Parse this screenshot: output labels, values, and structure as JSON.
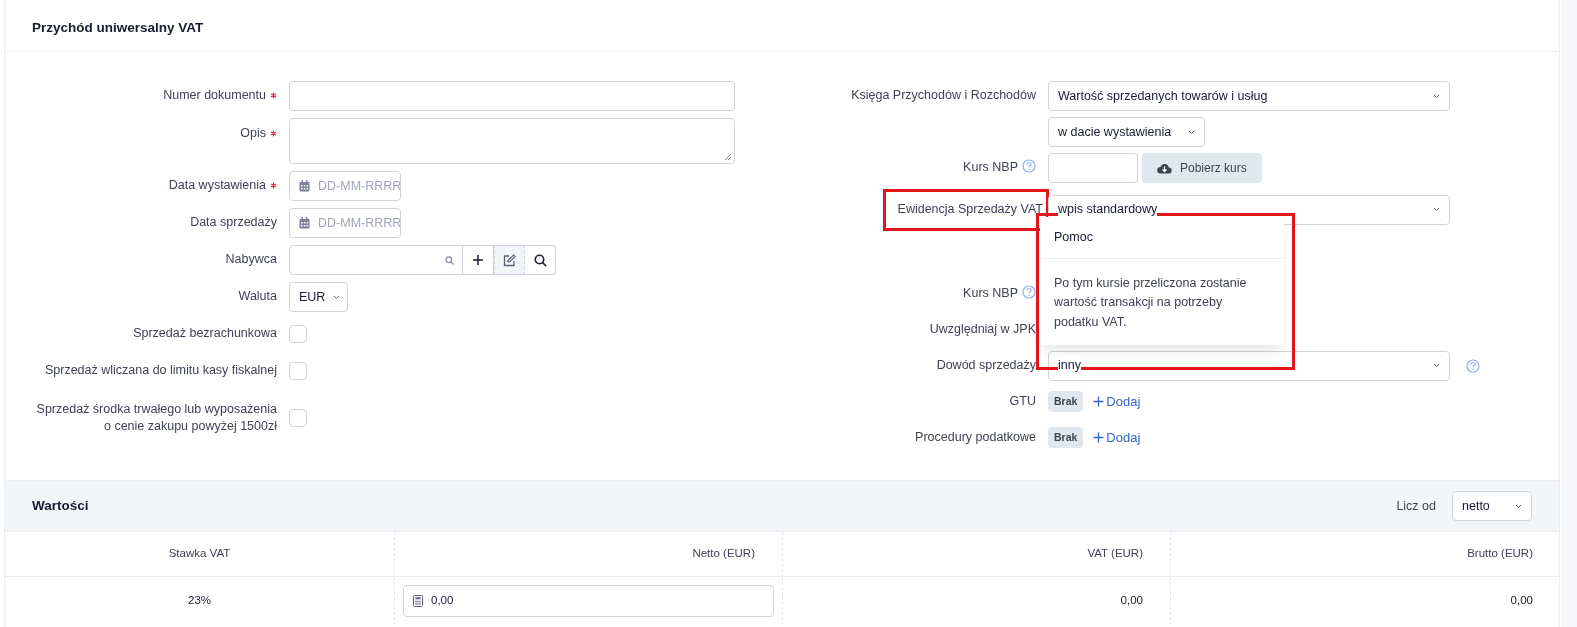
{
  "title": "Przychód uniwersalny VAT",
  "left_fields": [
    {
      "kind": "text",
      "label": "Numer dokumentu",
      "required": true
    },
    {
      "kind": "textarea",
      "label": "Opis",
      "required": true
    },
    {
      "kind": "date",
      "label": "Data wystawienia",
      "required": true,
      "placeholder": "DD-MM-RRRR"
    },
    {
      "kind": "date",
      "label": "Data sprzedaży",
      "required": false,
      "placeholder": "DD-MM-RRRR"
    },
    {
      "kind": "lookup",
      "label": "Nabywca",
      "required": false
    },
    {
      "kind": "select",
      "label": "Waluta",
      "required": false,
      "value": "EUR"
    },
    {
      "kind": "checkbox",
      "label": "Sprzedaż bezrachunkowa",
      "required": false,
      "checked": false
    },
    {
      "kind": "checkbox",
      "label": "Sprzedaż wliczana do limitu kasy fiskalnej",
      "required": false,
      "checked": false
    },
    {
      "kind": "checkbox",
      "label": "Sprzedaż środka trwałego lub wyposażenia o cenie zakupu powyżej 1500zł",
      "required": false,
      "checked": false
    }
  ],
  "right_fields": [
    {
      "kind": "select",
      "label": "Księga Przychodów i Rozchodów",
      "value": "Wartość sprzedanych towarów i usług",
      "help": false,
      "highlighted": false
    },
    {
      "kind": "subselect",
      "value": "w dacie wystawienia"
    },
    {
      "kind": "rate",
      "label": "Kurs NBP",
      "help": true,
      "button": "Pobierz kurs"
    },
    {
      "kind": "select",
      "label": "Ewidencja Sprzedaży VAT",
      "value": "wpis standardowy",
      "help": false,
      "highlighted": true,
      "popover": {
        "title": "Pomoc",
        "text": "Po tym kursie przeliczona zostanie wartość transakcji na potrzeby podatku VAT.",
        "highlighted": true
      }
    },
    {
      "kind": "covered",
      "label": "Kurs NBP",
      "help": true
    },
    {
      "kind": "covered",
      "label": "Uwzględniaj w JPK",
      "help": false
    },
    {
      "kind": "select",
      "label": "Dowód sprzedaży",
      "value": "inny",
      "help": true,
      "highlighted": false
    },
    {
      "kind": "tags",
      "label": "GTU",
      "badge": "Brak",
      "link": "Dodaj"
    },
    {
      "kind": "tags",
      "label": "Procedury podatkowe",
      "badge": "Brak",
      "link": "Dodaj"
    }
  ],
  "values": {
    "title": "Wartości",
    "calc_label": "Licz od",
    "calc_value": "netto",
    "columns": [
      "Stawka VAT",
      "Netto (EUR)",
      "VAT (EUR)",
      "Brutto (EUR)"
    ],
    "rows": [
      {
        "rate": "23%",
        "netto": "0,00",
        "vat": "0,00",
        "brutto": "0,00"
      }
    ]
  }
}
